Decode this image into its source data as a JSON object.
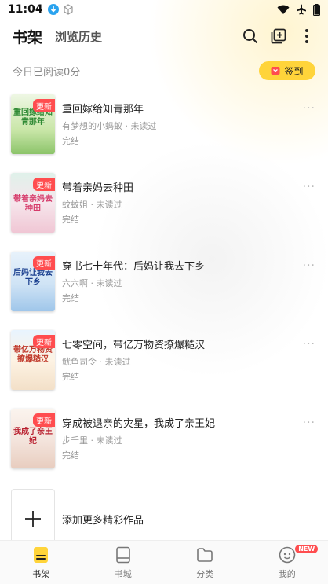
{
  "status_bar": {
    "time": "11:04"
  },
  "header": {
    "tab_bookshelf": "书架",
    "tab_history": "浏览历史"
  },
  "reading": {
    "text": "今日已阅读0分",
    "checkin_label": "签到"
  },
  "books": [
    {
      "title": "重回嫁给知青那年",
      "author": "有梦想的小蚂蚁",
      "progress": "未读过",
      "status": "完结",
      "badge": "更新",
      "cover_text": "重回嫁给知青那年"
    },
    {
      "title": "带着亲妈去种田",
      "author": "蚊蚊姐",
      "progress": "未读过",
      "status": "完结",
      "badge": "更新",
      "cover_text": "带着亲妈去种田"
    },
    {
      "title": "穿书七十年代：后妈让我去下乡",
      "author": "六六啊",
      "progress": "未读过",
      "status": "完结",
      "badge": "更新",
      "cover_text": "后妈让我去下乡"
    },
    {
      "title": "七零空间，带亿万物资撩爆糙汉",
      "author": "鱿鱼司令",
      "progress": "未读过",
      "status": "完结",
      "badge": "更新",
      "cover_text": "带亿万物资撩爆糙汉"
    },
    {
      "title": "穿成被退亲的灾星，我成了亲王妃",
      "author": "步千里",
      "progress": "未读过",
      "status": "完结",
      "badge": "更新",
      "cover_text": "我成了亲王妃"
    }
  ],
  "meta_separator": " · ",
  "add_more": {
    "label": "添加更多精彩作品"
  },
  "tabbar": {
    "bookshelf": "书架",
    "store": "书城",
    "category": "分类",
    "mine": "我的",
    "new_badge": "NEW"
  },
  "colors": {
    "accent_yellow": "#ffd43a",
    "badge_red": "#ff4d4f"
  }
}
